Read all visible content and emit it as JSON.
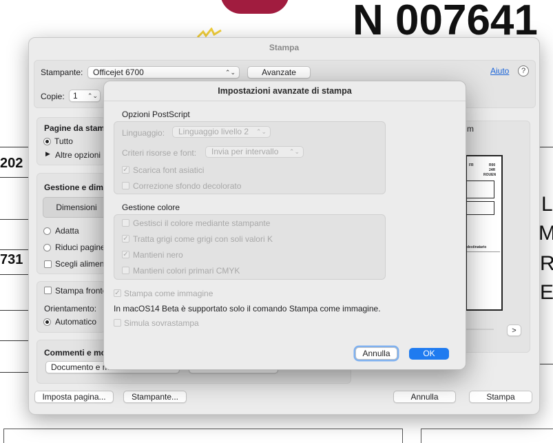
{
  "background_document": {
    "number": "N 007641",
    "fragments": [
      "202",
      "731"
    ],
    "letters": [
      "L",
      "M",
      "R",
      "E"
    ]
  },
  "print_window": {
    "title": "Stampa",
    "printer_label": "Stampante:",
    "printer_value": "Officejet 6700",
    "advanced_button": "Avanzate",
    "help_link": "Aiuto",
    "copies_label": "Copie:",
    "copies_value": "1",
    "pages_group": {
      "title": "Pagine da stamp",
      "all_option": "Tutto",
      "more_options": "Altre opzioni"
    },
    "size_group": {
      "title": "Gestione e dime",
      "segment_label": "Dimensioni",
      "fit_option": "Adatta",
      "shrink_option": "Riduci pagine",
      "choose_feed": "Scegli aliment"
    },
    "layout_group": {
      "duplex": "Stampa fronte",
      "orientation_label": "Orientamento:",
      "orientation_value": "Automatico"
    },
    "comments_group": {
      "title": "Commenti e mo",
      "document_popup": "Documento e m"
    },
    "preview_label": "m",
    "next_page": ">",
    "page_setup_button": "Imposta pagina...",
    "printer_button": "Stampante...",
    "cancel_button": "Annulla",
    "print_button": "Stampa"
  },
  "advanced_dialog": {
    "title": "Impostazioni avanzate di stampa",
    "postscript_section": "Opzioni PostScript",
    "language_label": "Linguaggio:",
    "language_value": "Linguaggio livello 2",
    "resources_label": "Criteri risorse e font:",
    "resources_value": "Invia per intervallo",
    "download_asian_fonts": "Scarica font asiatici",
    "background_correction": "Correzione sfondo decolorato",
    "color_section": "Gestione colore",
    "printer_color": "Gestisci il colore mediante stampante",
    "gray_as_gray": "Tratta grigi come grigi con soli valori K",
    "keep_black": "Mantieni nero",
    "keep_cmyk": "Mantieni colori primari CMYK",
    "print_as_image": "Stampa come immagine",
    "beta_notice": "In macOS14 Beta è supportato solo il comando Stampa come immagine.",
    "simulate_overprint": "Simula sovrastampa",
    "cancel_button": "Annulla",
    "ok_button": "OK"
  },
  "thumbnail_text": {
    "code": "FR",
    "r1": "R00",
    "r2": "24R",
    "city": "ROUEN",
    "recipient": "destinatario"
  },
  "colors": {
    "accent": "#1f7bf0",
    "focus_ring": "#7fb1ef",
    "link": "#1a64d8",
    "logo": "#a11c3f"
  }
}
